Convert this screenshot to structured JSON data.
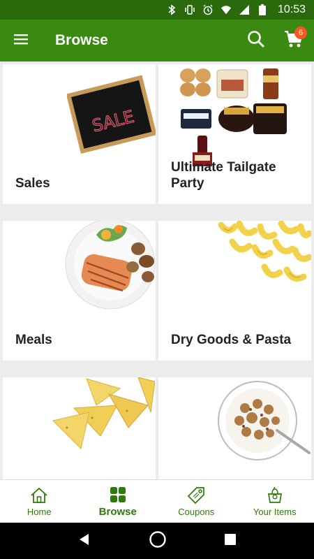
{
  "status_bar": {
    "time": "10:53"
  },
  "app_bar": {
    "title": "Browse",
    "cart_count": "6"
  },
  "tiles": [
    {
      "label": "Sales",
      "image": "sale-chalkboard"
    },
    {
      "label": "Ultimate Tailgate Party",
      "image": "tailgate-products"
    },
    {
      "label": "Meals",
      "image": "salmon-plate"
    },
    {
      "label": "Dry Goods & Pasta",
      "image": "macaroni"
    },
    {
      "label": "",
      "image": "tortilla-chips"
    },
    {
      "label": "",
      "image": "cereal-bowl"
    }
  ],
  "sale_sign_text": "SALE",
  "bottom_nav": [
    {
      "label": "Home",
      "icon": "home-icon"
    },
    {
      "label": "Browse",
      "icon": "grid-icon",
      "active": true
    },
    {
      "label": "Coupons",
      "icon": "coupon-icon"
    },
    {
      "label": "Your Items",
      "icon": "basket-icon"
    }
  ],
  "colors": {
    "app_bar": "#3a8a12",
    "status_bar": "#2a6a0d",
    "accent": "#2f7a0c",
    "badge": "#f15a22"
  }
}
